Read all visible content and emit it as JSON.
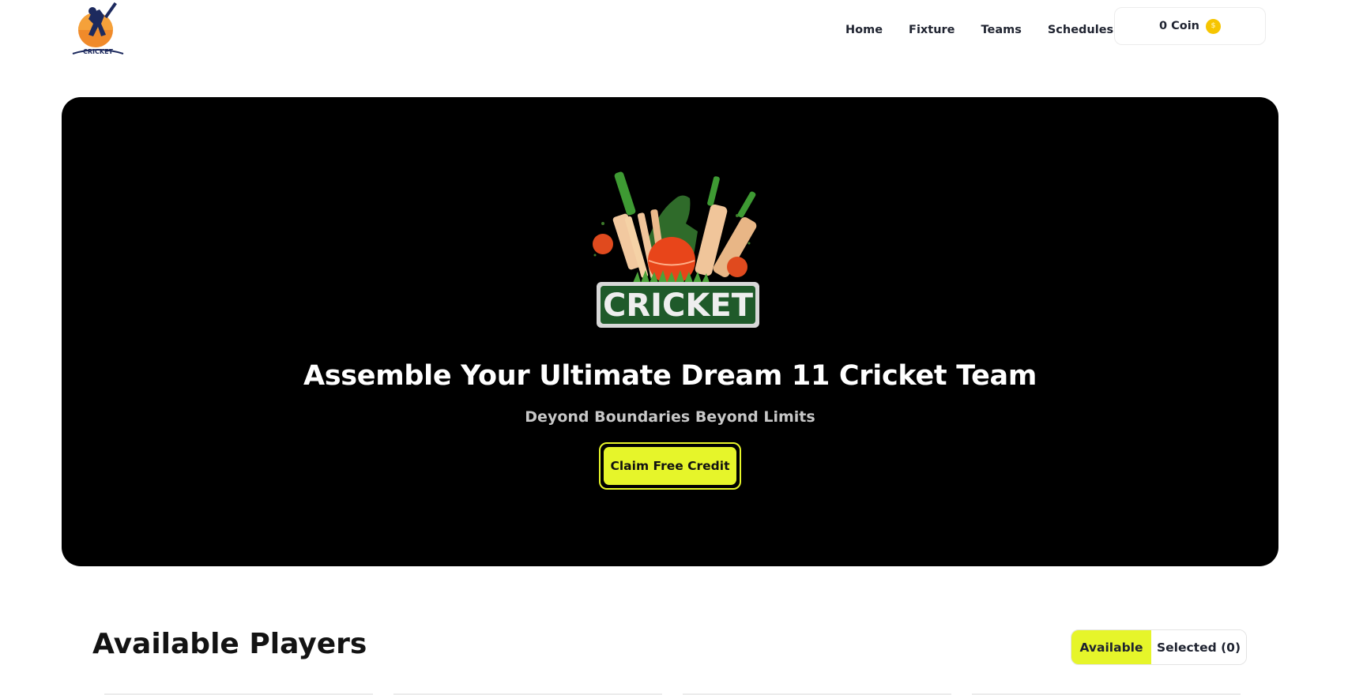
{
  "nav": {
    "logo_icon": "cricket-batsman-logo",
    "links": [
      "Home",
      "Fixture",
      "Teams",
      "Schedules"
    ],
    "coin_label": "0 Coin",
    "coin_icon": "gold-coin-icon"
  },
  "hero": {
    "logo_icon": "cricket-emblem-logo",
    "logo_text": "CRICKET",
    "title": "Assemble Your Ultimate Dream 11 Cricket Team",
    "subtitle": "Deyond Boundaries Beyond Limits",
    "cta_label": "Claim Free Credit"
  },
  "players": {
    "title": "Available Players",
    "tabs": [
      {
        "label": "Available",
        "active": true
      },
      {
        "label": "Selected (0)",
        "active": false
      }
    ]
  },
  "colors": {
    "accent": "#e6f52a",
    "hero_bg": "#000000",
    "coin": "#f6c500"
  }
}
